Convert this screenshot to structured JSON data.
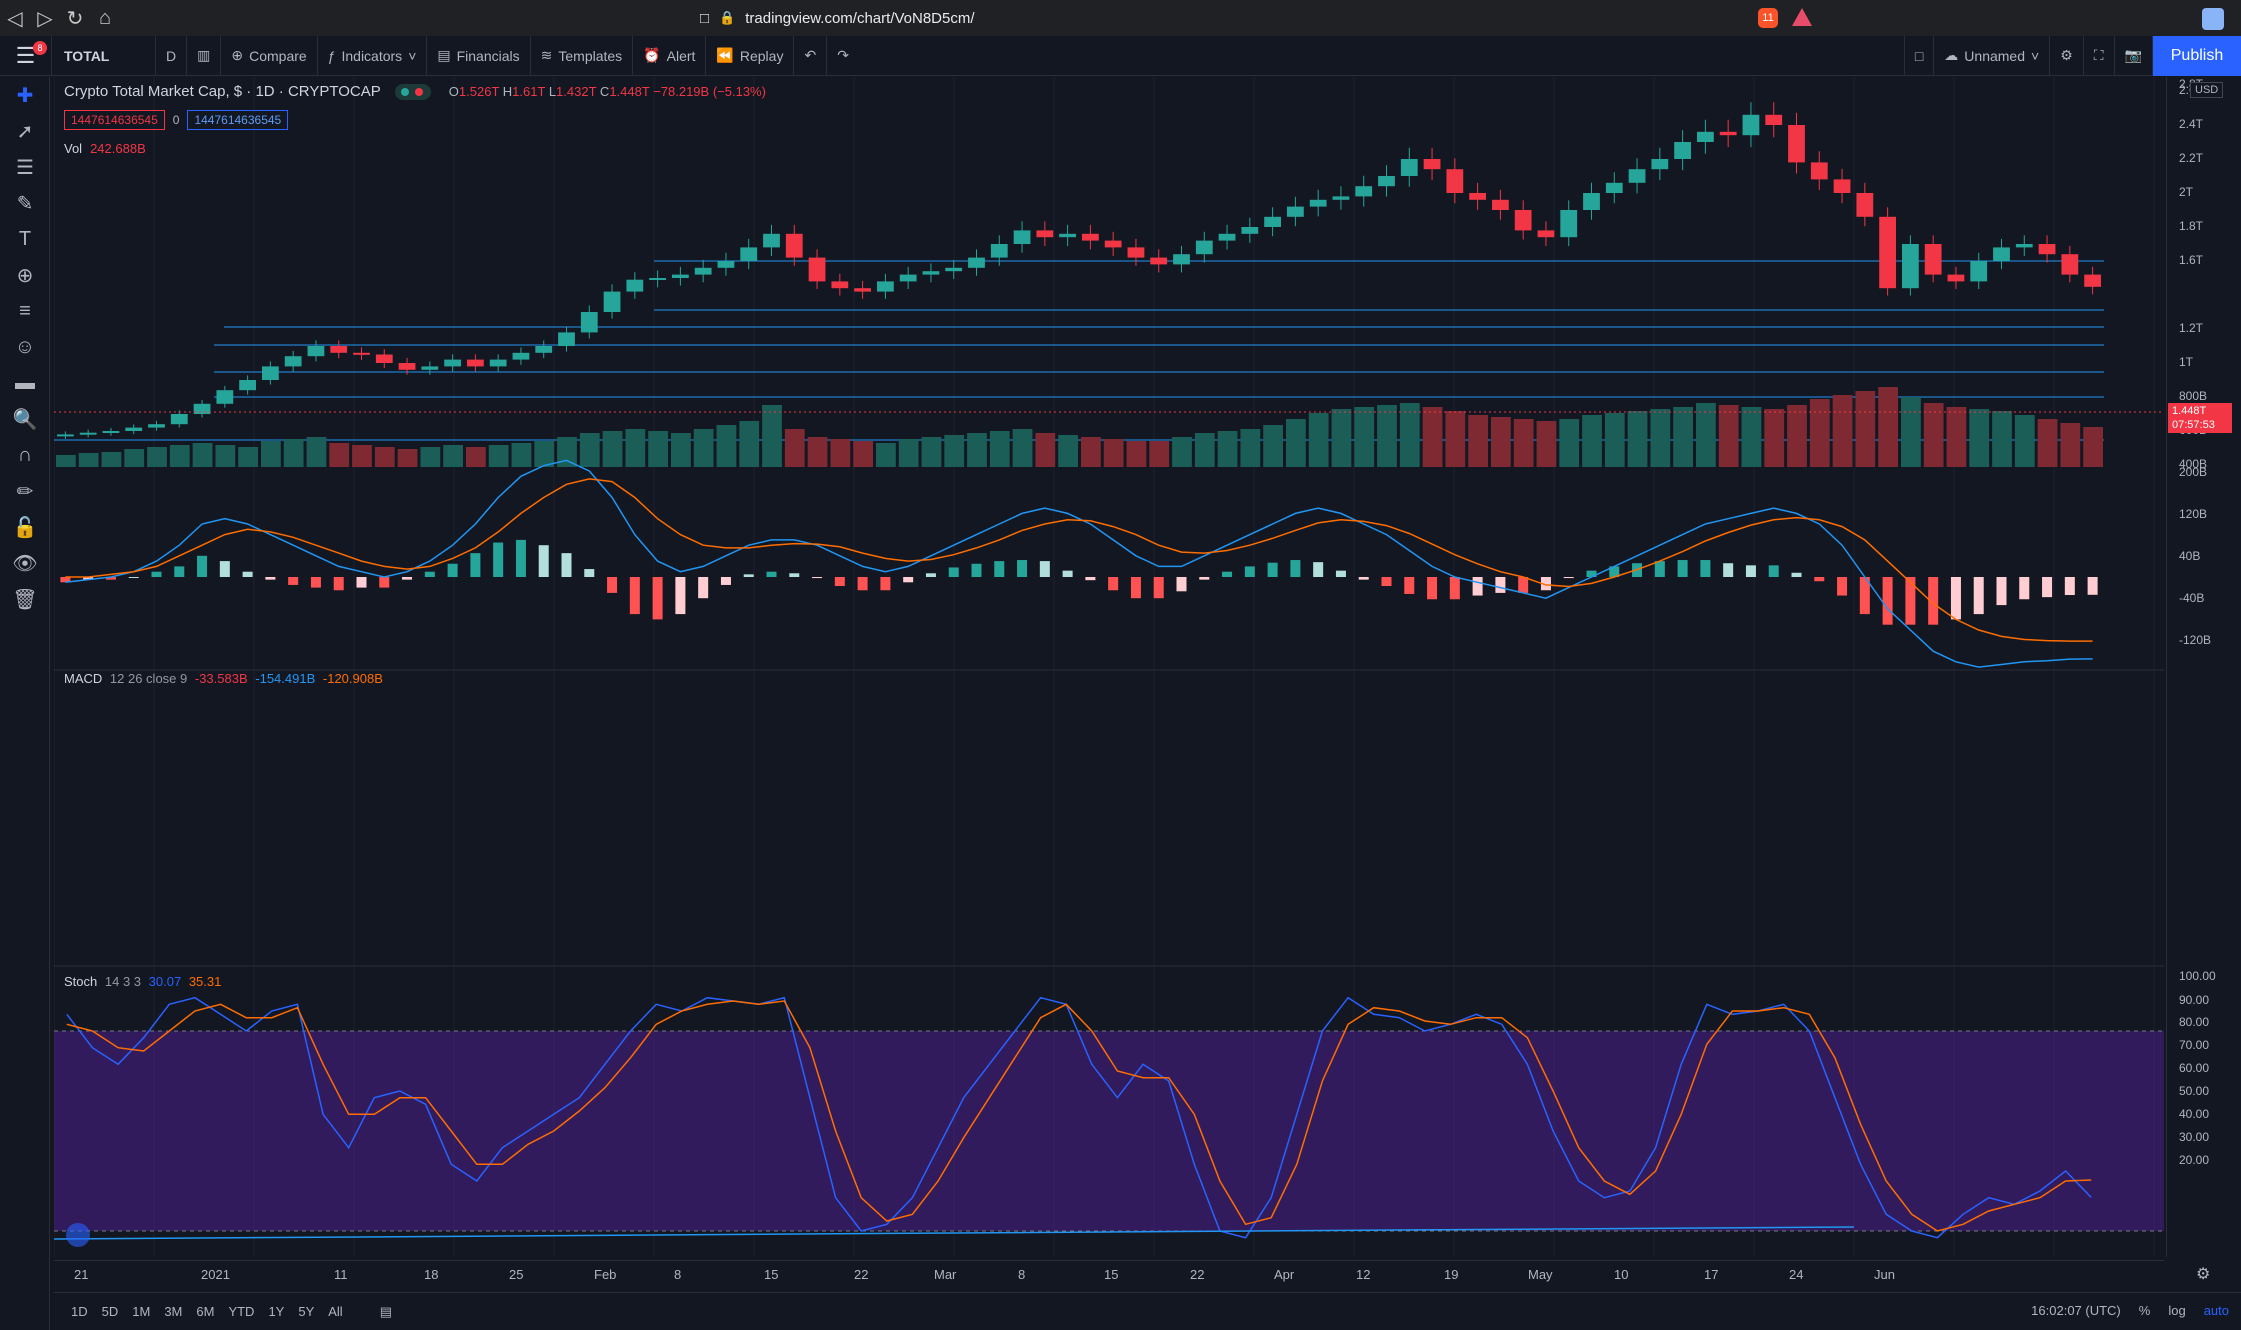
{
  "browser": {
    "url": "tradingview.com/chart/VoN8D5cm/",
    "badge_count": "11"
  },
  "toolbar": {
    "menu_badge": "8",
    "symbol": "TOTAL",
    "interval": "D",
    "compare": "Compare",
    "indicators": "Indicators",
    "financials": "Financials",
    "templates": "Templates",
    "alert": "Alert",
    "replay": "Replay",
    "layout_name": "Unnamed",
    "publish": "Publish"
  },
  "legend": {
    "title": "Crypto Total Market Cap, $ · 1D · CRYPTOCAP",
    "open": "1.526T",
    "high": "1.61T",
    "low": "1.432T",
    "close": "1.448T",
    "change": "−78.219B (−5.13%)",
    "box_left": "1447614636545",
    "box_zero": "0",
    "box_right": "1447614636545",
    "vol_label": "Vol",
    "vol_value": "242.688B"
  },
  "macd": {
    "label": "MACD",
    "params": "12 26 close 9",
    "v1": "-33.583B",
    "v2": "-154.491B",
    "v3": "-120.908B"
  },
  "stoch": {
    "label": "Stoch",
    "params": "14 3 3",
    "k": "30.07",
    "d": "35.31"
  },
  "price_axis": {
    "currency": "USD",
    "ticks": [
      "2.8T",
      "2.6T",
      "2.4T",
      "2.2T",
      "2T",
      "1.8T",
      "1.6T",
      "1.2T",
      "1T",
      "800B",
      "600B",
      "400B"
    ],
    "last_price": "1.448T",
    "countdown": "07:57:53",
    "macd_ticks": [
      "200B",
      "120B",
      "40B",
      "-40B",
      "-120B"
    ],
    "stoch_ticks": [
      "100.00",
      "90.00",
      "80.00",
      "70.00",
      "60.00",
      "50.00",
      "40.00",
      "30.00",
      "20.00"
    ]
  },
  "time_axis": [
    "21",
    "2021",
    "11",
    "18",
    "25",
    "Feb",
    "8",
    "15",
    "22",
    "Mar",
    "8",
    "15",
    "22",
    "Apr",
    "12",
    "19",
    "May",
    "10",
    "17",
    "24",
    "Jun"
  ],
  "bottom": {
    "ranges": [
      "1D",
      "5D",
      "1M",
      "3M",
      "6M",
      "YTD",
      "1Y",
      "5Y",
      "All"
    ],
    "clock": "16:02:07 (UTC)",
    "pct": "%",
    "log": "log",
    "auto": "auto"
  },
  "colors": {
    "bg": "#131722",
    "up": "#26a69a",
    "down": "#f23645",
    "macd_line": "#2196f3",
    "signal_line": "#ff6d00",
    "stoch_band": "#311b92",
    "hline": "#2196f3"
  },
  "chart_data": {
    "type": "line",
    "title": "Crypto Total Market Cap, $ · 1D · CRYPTOCAP",
    "ylabel": "",
    "xlabel": "",
    "ylim": [
      400,
      2800
    ],
    "x_labels": [
      "21",
      "2021",
      "11",
      "18",
      "25",
      "Feb",
      "8",
      "15",
      "22",
      "Mar",
      "8",
      "15",
      "22",
      "Apr",
      "12",
      "19",
      "May",
      "10",
      "17",
      "24",
      "Jun"
    ],
    "series": [
      {
        "name": "close",
        "values": [
          580,
          590,
          600,
          620,
          640,
          700,
          760,
          840,
          900,
          980,
          1040,
          1100,
          1060,
          1050,
          1000,
          960,
          980,
          1020,
          980,
          1020,
          1060,
          1100,
          1180,
          1300,
          1420,
          1490,
          1500,
          1520,
          1560,
          1600,
          1680,
          1760,
          1620,
          1480,
          1440,
          1420,
          1480,
          1520,
          1540,
          1560,
          1620,
          1700,
          1780,
          1740,
          1760,
          1720,
          1680,
          1620,
          1580,
          1640,
          1720,
          1760,
          1800,
          1860,
          1920,
          1960,
          1980,
          2040,
          2100,
          2200,
          2140,
          2000,
          1960,
          1900,
          1780,
          1740,
          1900,
          2000,
          2060,
          2140,
          2200,
          2300,
          2360,
          2340,
          2460,
          2400,
          2180,
          2080,
          2000,
          1860,
          1440,
          1700,
          1520,
          1480,
          1600,
          1680,
          1700,
          1640,
          1520,
          1448
        ]
      }
    ],
    "volume_billions": [
      120,
      140,
      150,
      180,
      200,
      220,
      240,
      220,
      200,
      260,
      280,
      300,
      240,
      220,
      200,
      180,
      200,
      220,
      200,
      220,
      240,
      260,
      300,
      340,
      360,
      380,
      360,
      340,
      380,
      420,
      460,
      620,
      380,
      300,
      280,
      260,
      240,
      280,
      300,
      320,
      340,
      360,
      380,
      340,
      320,
      300,
      280,
      260,
      260,
      300,
      340,
      360,
      380,
      420,
      480,
      540,
      580,
      600,
      620,
      640,
      600,
      560,
      520,
      500,
      480,
      460,
      480,
      520,
      540,
      560,
      580,
      600,
      640,
      620,
      600,
      580,
      620,
      680,
      720,
      760,
      800,
      700,
      640,
      600,
      580,
      560,
      520,
      480,
      440,
      400
    ],
    "macd_line": [
      -10,
      -5,
      0,
      10,
      30,
      60,
      100,
      110,
      100,
      80,
      60,
      40,
      20,
      10,
      0,
      10,
      30,
      60,
      100,
      150,
      190,
      210,
      220,
      200,
      150,
      80,
      30,
      10,
      20,
      40,
      60,
      70,
      70,
      60,
      40,
      20,
      10,
      20,
      40,
      60,
      80,
      100,
      120,
      130,
      120,
      100,
      70,
      40,
      20,
      20,
      40,
      60,
      80,
      100,
      120,
      130,
      120,
      100,
      80,
      50,
      20,
      0,
      -10,
      -20,
      -30,
      -40,
      -20,
      0,
      20,
      40,
      60,
      80,
      100,
      110,
      120,
      130,
      120,
      100,
      60,
      0,
      -60,
      -100,
      -140,
      -160,
      -170,
      -165,
      -160,
      -158,
      -155,
      -154.491
    ],
    "signal_line": [
      0,
      0,
      5,
      10,
      20,
      40,
      60,
      80,
      90,
      85,
      75,
      60,
      45,
      30,
      20,
      15,
      20,
      35,
      55,
      85,
      120,
      150,
      175,
      185,
      180,
      150,
      110,
      80,
      60,
      55,
      55,
      60,
      63,
      62,
      57,
      45,
      35,
      30,
      33,
      42,
      55,
      70,
      88,
      100,
      108,
      106,
      95,
      80,
      60,
      47,
      45,
      50,
      60,
      73,
      88,
      102,
      108,
      105,
      97,
      82,
      62,
      42,
      25,
      10,
      0,
      -15,
      -18,
      -12,
      0,
      14,
      30,
      48,
      68,
      84,
      98,
      108,
      112,
      108,
      95,
      70,
      30,
      -10,
      -50,
      -80,
      -100,
      -112,
      -118,
      -120,
      -121,
      -120.908
    ],
    "stoch_k": [
      85,
      75,
      70,
      78,
      88,
      90,
      85,
      80,
      86,
      88,
      55,
      45,
      60,
      62,
      58,
      40,
      35,
      45,
      50,
      55,
      60,
      70,
      80,
      88,
      86,
      90,
      89,
      88,
      90,
      60,
      30,
      20,
      22,
      30,
      45,
      60,
      70,
      80,
      90,
      88,
      70,
      60,
      70,
      65,
      40,
      20,
      18,
      30,
      55,
      80,
      90,
      85,
      84,
      80,
      82,
      85,
      82,
      70,
      50,
      35,
      30,
      32,
      45,
      70,
      88,
      85,
      86,
      88,
      80,
      60,
      40,
      25,
      20,
      18,
      25,
      30,
      28,
      32,
      38,
      30.07
    ],
    "stoch_d": [
      82,
      80,
      75,
      74,
      80,
      86,
      88,
      84,
      84,
      87,
      70,
      55,
      55,
      60,
      60,
      50,
      40,
      40,
      46,
      50,
      56,
      63,
      72,
      82,
      86,
      88,
      89,
      88,
      89,
      75,
      50,
      30,
      23,
      25,
      35,
      48,
      60,
      72,
      84,
      88,
      80,
      68,
      66,
      66,
      55,
      35,
      22,
      24,
      40,
      65,
      82,
      87,
      86,
      83,
      82,
      84,
      84,
      78,
      62,
      45,
      35,
      31,
      38,
      55,
      76,
      86,
      86,
      87,
      85,
      72,
      52,
      35,
      25,
      20,
      22,
      26,
      28,
      30,
      35,
      35.31
    ]
  }
}
